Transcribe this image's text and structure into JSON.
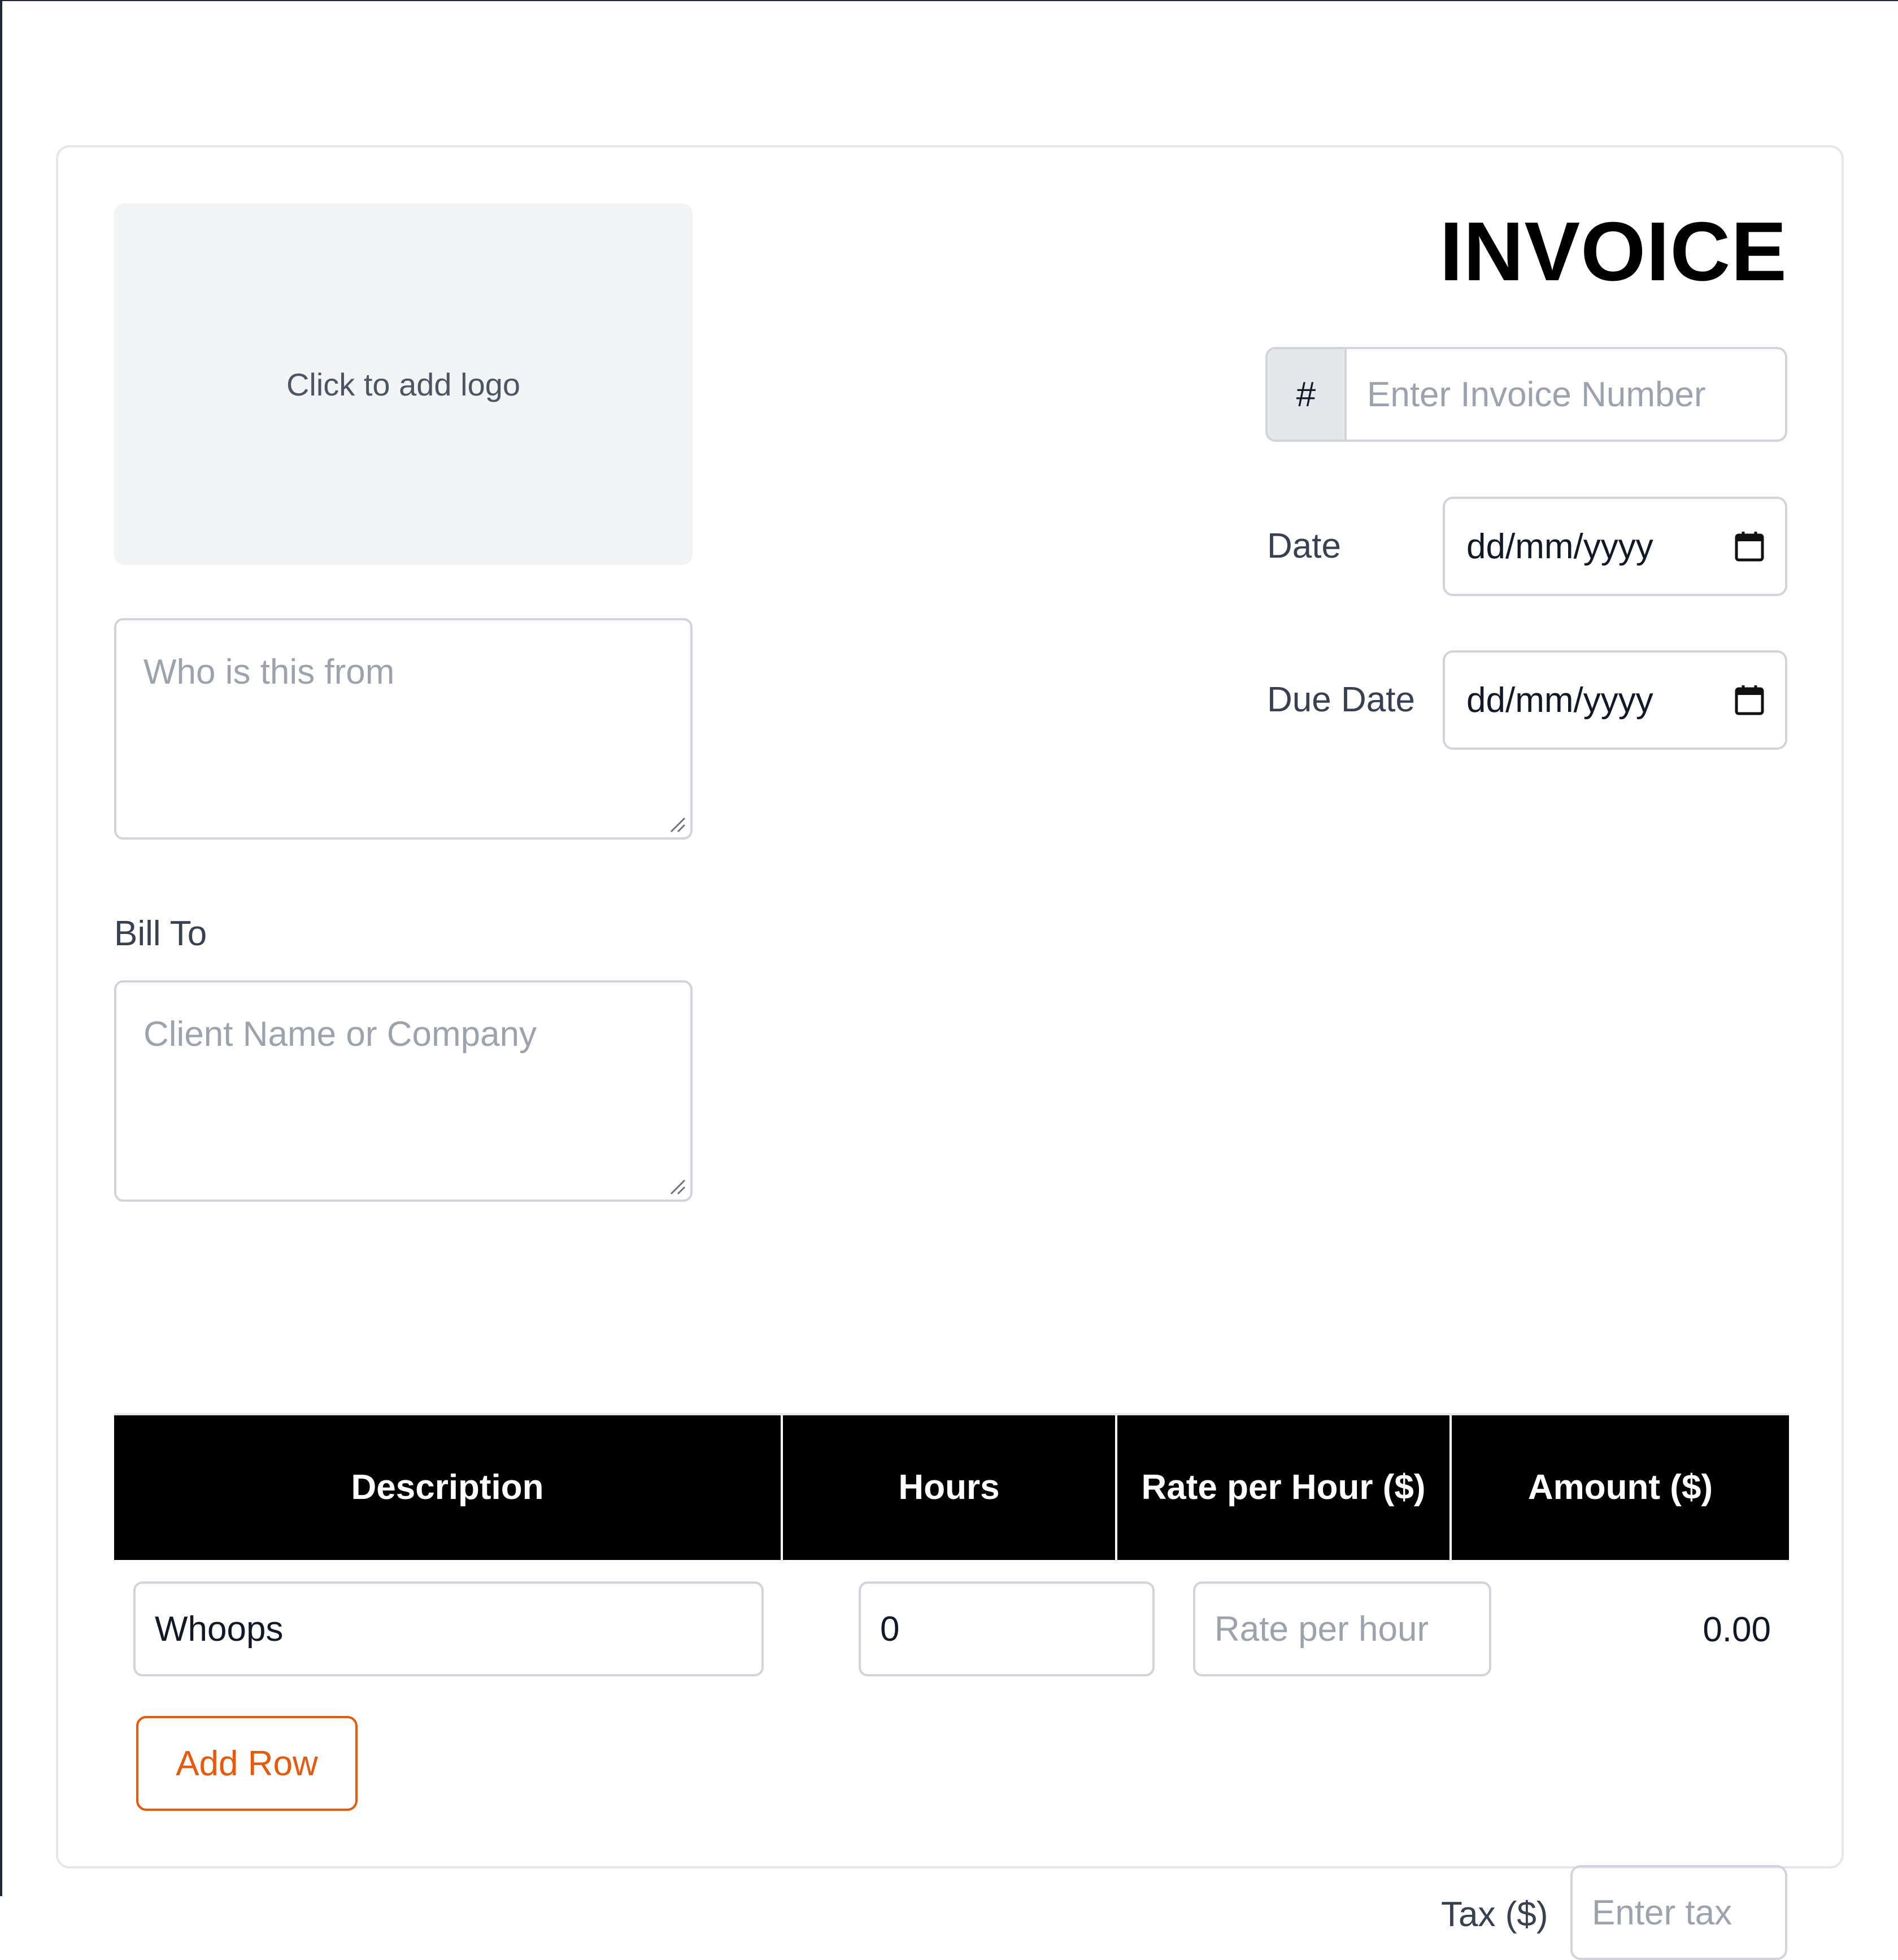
{
  "invoice": {
    "title": "INVOICE",
    "logo_placeholder": "Click to add logo",
    "from_placeholder": "Who is this from",
    "bill_to_label": "Bill To",
    "bill_to_placeholder": "Client Name or Company",
    "number_prefix": "#",
    "number_placeholder": "Enter Invoice Number",
    "date_label": "Date",
    "date_value": "dd/mm/yyyy",
    "due_date_label": "Due Date",
    "due_date_value": "dd/mm/yyyy"
  },
  "table": {
    "headers": [
      "Description",
      "Hours",
      "Rate per Hour ($)",
      "Amount ($)"
    ],
    "rows": [
      {
        "description": "Whoops",
        "hours": "0",
        "rate_placeholder": "Rate per hour",
        "amount": "0.00"
      }
    ],
    "add_row_label": "Add Row"
  },
  "totals": {
    "tax_label": "Tax ($)",
    "tax_placeholder": "Enter tax"
  },
  "colors": {
    "accent": "#ea580c",
    "header_bg": "#000000",
    "border": "#d1d5db",
    "logo_bg": "#f3f4f6"
  }
}
